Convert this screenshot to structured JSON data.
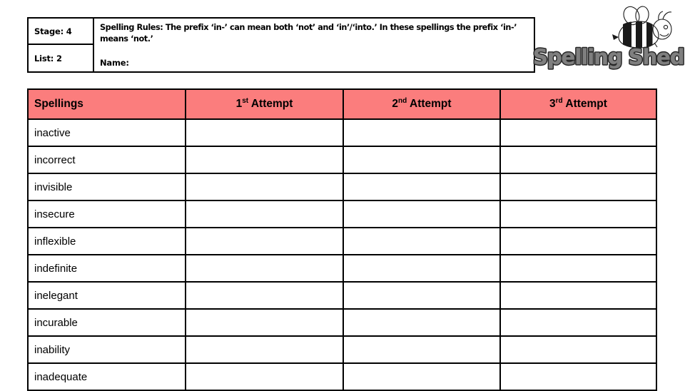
{
  "info": {
    "stage_label": "Stage: 4",
    "list_label": "List: 2",
    "spelling_rules": "Spelling Rules: The prefix ‘in-’  can mean both ‘not’ and ‘in’/‘into.’ In these spellings the prefix ‘in-’ means ‘not.’",
    "name_label": "Name:"
  },
  "logo": {
    "wordmark": "Spelling Shed",
    "bee_icon": "bee-icon"
  },
  "table": {
    "headers": {
      "spellings": "Spellings",
      "attempt1_num": "1",
      "attempt1_ord": "st",
      "attempt1_word": "Attempt",
      "attempt2_num": "2",
      "attempt2_ord": "nd",
      "attempt2_word": "Attempt",
      "attempt3_num": "3",
      "attempt3_ord": "rd",
      "attempt3_word": "Attempt"
    },
    "header_bg_color": "#fb7d7d",
    "words": [
      "inactive",
      "incorrect",
      "invisible",
      "insecure",
      "inflexible",
      "indefinite",
      "inelegant",
      "incurable",
      "inability",
      "inadequate"
    ],
    "attempt_values": {
      "attempt1": [
        "",
        "",
        "",
        "",
        "",
        "",
        "",
        "",
        "",
        ""
      ],
      "attempt2": [
        "",
        "",
        "",
        "",
        "",
        "",
        "",
        "",
        "",
        ""
      ],
      "attempt3": [
        "",
        "",
        "",
        "",
        "",
        "",
        "",
        "",
        "",
        ""
      ]
    }
  }
}
